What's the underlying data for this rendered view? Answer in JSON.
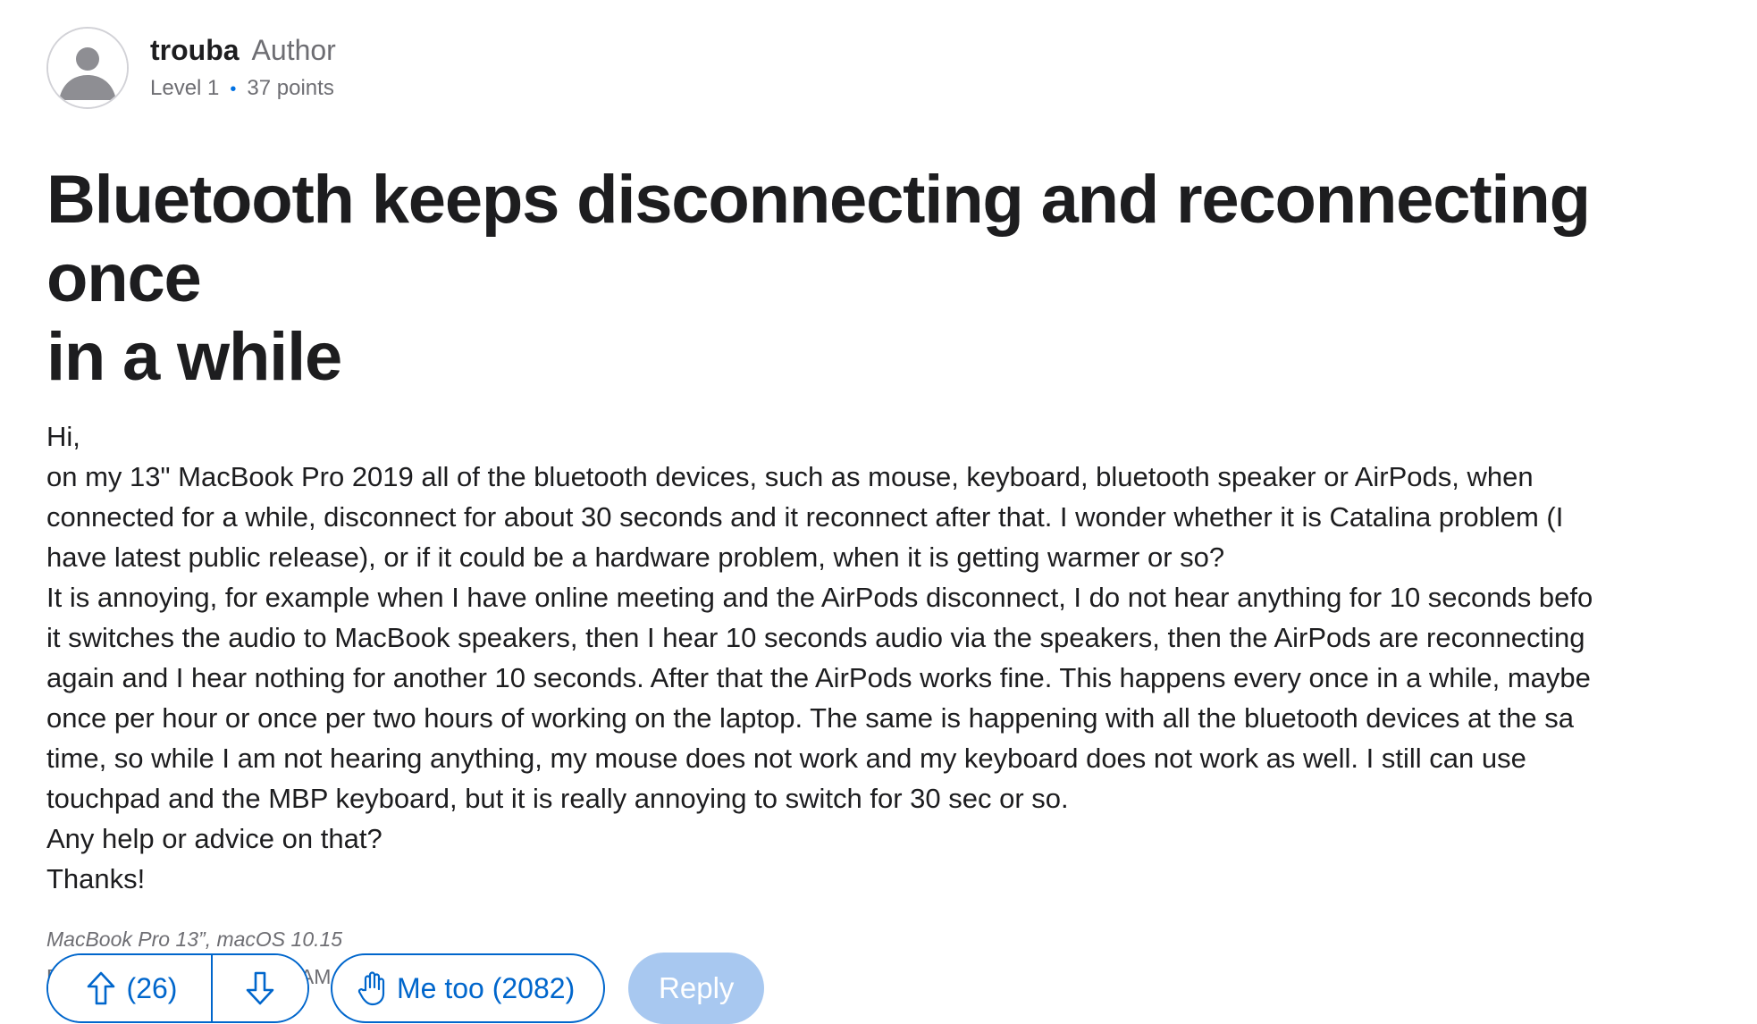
{
  "author": {
    "name": "trouba",
    "badge": "Author",
    "level": "Level 1",
    "points": "37 points",
    "avatar_icon": "default-user-avatar"
  },
  "post": {
    "title_lines": [
      "Bluetooth keeps disconnecting and reconnecting once",
      "in a while"
    ],
    "body_lines": [
      "Hi,",
      "on my 13\" MacBook Pro 2019 all of the bluetooth devices, such as mouse, keyboard, bluetooth speaker or AirPods, when",
      "connected for a while, disconnect for about 30 seconds and it reconnect after that. I wonder whether it is Catalina problem (I",
      "have latest public release), or if it could be a hardware problem, when it is getting warmer or so?",
      "It is annoying, for example when I have online meeting and the AirPods disconnect, I do not hear anything for 10 seconds befo",
      "it switches the audio to MacBook speakers, then I hear 10 seconds audio via the speakers, then the AirPods are reconnecting",
      "again and I hear nothing for another 10 seconds. After that the AirPods works fine. This happens every once in a while, maybe",
      "once per hour or once per two hours of working on the laptop. The same is happening with all the bluetooth devices at the sa",
      "time, so while I am not hearing anything, my mouse does not work and my keyboard does not work as well. I still can use",
      "touchpad and the MBP keyboard, but it is really annoying to switch for 30 sec or so.",
      "Any help or advice on that?",
      "Thanks!"
    ],
    "device_info": "MacBook Pro 13”, macOS 10.15",
    "posted": "Posted on Apr 6, 2020 9:45 AM"
  },
  "actions": {
    "upvote_count": "(26)",
    "metoo_label": "Me too (2082)",
    "reply_label": "Reply",
    "upvote_icon": "arrow-up-icon",
    "downvote_icon": "arrow-down-icon",
    "metoo_icon": "raised-hand-icon"
  },
  "colors": {
    "accent": "#0066cc",
    "reply_disabled": "#a8c8f0",
    "text": "#1d1d1f",
    "muted": "#6e6e73"
  }
}
